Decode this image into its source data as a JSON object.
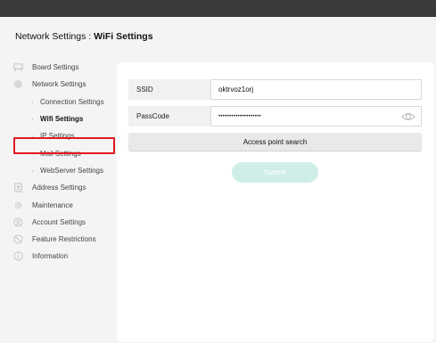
{
  "page": {
    "title_prefix": "Network Settings : ",
    "title_bold": "WiFi Settings"
  },
  "sidebar": {
    "items": [
      {
        "label": "Board Settings",
        "icon": "board-icon"
      },
      {
        "label": "Network Settings",
        "icon": "network-icon"
      },
      {
        "label": "Connection Settings",
        "sub": true
      },
      {
        "label": "Wifi Settings",
        "sub": true,
        "active": true
      },
      {
        "label": "IP Settings",
        "sub": true
      },
      {
        "label": "Mail Settings",
        "sub": true
      },
      {
        "label": "WebServer Settings",
        "sub": true
      },
      {
        "label": "Address Settings",
        "icon": "address-book-icon"
      },
      {
        "label": "Maintenance",
        "icon": "gear-icon"
      },
      {
        "label": "Account Settings",
        "icon": "account-icon"
      },
      {
        "label": "Feature Restrictions",
        "icon": "restriction-icon"
      },
      {
        "label": "Information",
        "icon": "info-icon"
      }
    ]
  },
  "form": {
    "ssid_label": "SSID",
    "ssid_value": "oktrvoz1orj",
    "passcode_label": "PassCode",
    "passcode_value": "••••••••••••••••••••",
    "ap_search_label": "Access point search",
    "submit_label": "Submit"
  },
  "colors": {
    "topbar": "#3b3b3b",
    "highlight": "#e0191f",
    "submit_bg": "#cfeee8"
  }
}
